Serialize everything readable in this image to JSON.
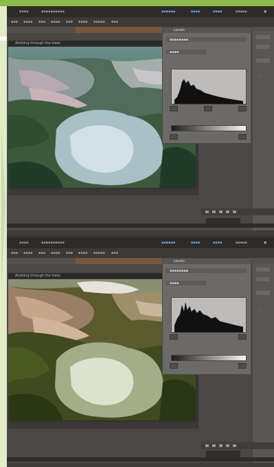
{
  "top_screenshot": {
    "panel_title": "Levels",
    "doc_tab": "Ambling through the trees"
  },
  "bottom_screenshot": {
    "panel_title": "Levels",
    "doc_tab": "Ambling through the trees"
  },
  "colors": {
    "accent_green": "#8dba4a",
    "app_bg": "#4a4846",
    "panel_bg": "#6c6a68"
  }
}
